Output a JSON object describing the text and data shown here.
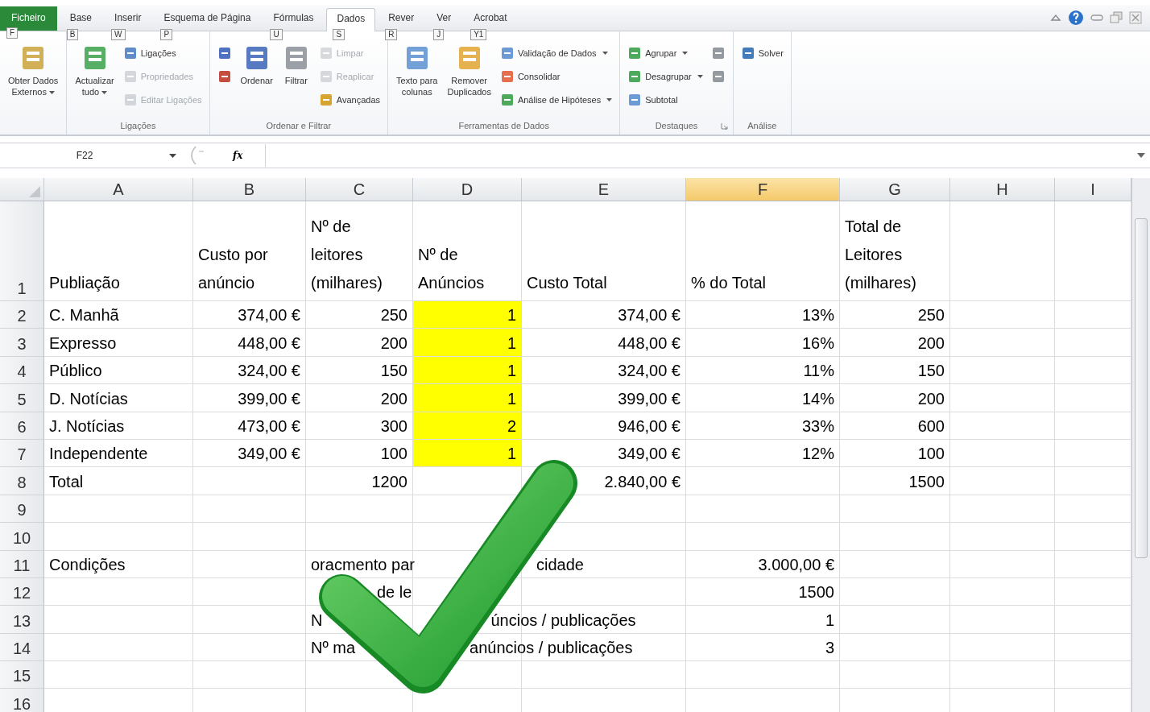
{
  "tabs": [
    {
      "label": "Ficheiro",
      "keytip": "F",
      "kind": "file",
      "selected": false
    },
    {
      "label": "Base",
      "keytip": "B",
      "kind": "tab",
      "selected": false
    },
    {
      "label": "Inserir",
      "keytip": "W",
      "kind": "tab",
      "selected": false
    },
    {
      "label": "Esquema de Página",
      "keytip": "P",
      "kind": "tab",
      "selected": false
    },
    {
      "label": "Fórmulas",
      "keytip": "U",
      "kind": "tab",
      "selected": false
    },
    {
      "label": "Dados",
      "keytip": "S",
      "kind": "tab",
      "selected": true
    },
    {
      "label": "Rever",
      "keytip": "R",
      "kind": "tab",
      "selected": false
    },
    {
      "label": "Ver",
      "keytip": "J",
      "kind": "tab",
      "selected": false
    },
    {
      "label": "Acrobat",
      "keytip": "Y1",
      "kind": "tab",
      "selected": false
    }
  ],
  "ribbon_groups": [
    {
      "items": [
        {
          "label": "Obter Dados\nExternos",
          "kind": "large",
          "dropdown": true,
          "disabled": false
        }
      ]
    },
    {
      "label": "Ligações",
      "items": [
        {
          "label": "Actualizar\ntudo",
          "kind": "large",
          "dropdown": true,
          "disabled": false
        },
        {
          "label": "Ligações",
          "kind": "small",
          "dropdown": false,
          "disabled": false
        },
        {
          "label": "Propriedades",
          "kind": "small",
          "dropdown": false,
          "disabled": true
        },
        {
          "label": "Editar Ligações",
          "kind": "small",
          "dropdown": false,
          "disabled": true
        }
      ]
    },
    {
      "label": "Ordenar e Filtrar",
      "items": [
        {
          "kind": "small",
          "dropdown": false,
          "disabled": false
        },
        {
          "kind": "small",
          "dropdown": false,
          "disabled": false
        },
        {
          "label": "Ordenar",
          "kind": "large",
          "dropdown": false,
          "disabled": false
        },
        {
          "label": "Filtrar",
          "kind": "large",
          "dropdown": false,
          "disabled": false
        },
        {
          "label": "Limpar",
          "kind": "small",
          "dropdown": false,
          "disabled": true
        },
        {
          "label": "Reaplicar",
          "kind": "small",
          "dropdown": false,
          "disabled": true
        },
        {
          "label": "Avançadas",
          "kind": "small",
          "dropdown": false,
          "disabled": false
        }
      ]
    },
    {
      "label": "Ferramentas de Dados",
      "items": [
        {
          "label": "Texto para\ncolunas",
          "kind": "large",
          "dropdown": false,
          "disabled": false
        },
        {
          "label": "Remover\nDuplicados",
          "kind": "large",
          "dropdown": false,
          "disabled": false
        },
        {
          "label": "Validação de Dados",
          "kind": "small",
          "dropdown": true,
          "disabled": false
        },
        {
          "label": "Consolidar",
          "kind": "small",
          "dropdown": false,
          "disabled": false
        },
        {
          "label": "Análise de Hipóteses",
          "kind": "small",
          "dropdown": true,
          "disabled": false
        }
      ]
    },
    {
      "label": "Destaques",
      "launcher": true,
      "items": [
        {
          "label": "Agrupar",
          "kind": "small",
          "dropdown": true,
          "disabled": false
        },
        {
          "label": "Desagrupar",
          "kind": "small",
          "dropdown": true,
          "disabled": false
        },
        {
          "label": "Subtotal",
          "kind": "small",
          "dropdown": false,
          "disabled": false
        },
        {
          "kind": "small",
          "dropdown": false,
          "disabled": false
        },
        {
          "kind": "small",
          "dropdown": false,
          "disabled": false
        }
      ]
    },
    {
      "label": "Análise",
      "launcher": false,
      "items": [
        {
          "label": "Solver",
          "kind": "small",
          "dropdown": false,
          "disabled": false
        }
      ]
    }
  ],
  "formula_bar": {
    "name_box": "F22",
    "function_label": "fx"
  },
  "columns": [
    {
      "label": "A",
      "selected": false
    },
    {
      "label": "B",
      "selected": false
    },
    {
      "label": "C",
      "selected": false
    },
    {
      "label": "D",
      "selected": false
    },
    {
      "label": "E",
      "selected": false
    },
    {
      "label": "F",
      "selected": true
    },
    {
      "label": "G",
      "selected": false
    },
    {
      "label": "H",
      "selected": false
    },
    {
      "label": "I",
      "selected": false
    }
  ],
  "rows": [
    {
      "header": "1",
      "cells": [
        {
          "text": "Publiação",
          "kind": "text"
        },
        {
          "text": "Custo por\nanúncio",
          "kind": "text"
        },
        {
          "text": "Nº de\nleitores\n(milhares)",
          "kind": "text"
        },
        {
          "text": "Nº de\nAnúncios",
          "kind": "text"
        },
        {
          "text": "Custo Total",
          "kind": "text"
        },
        {
          "text": "% do Total",
          "kind": "text"
        },
        {
          "text": "Total de\nLeitores\n(milhares)",
          "kind": "text"
        },
        null,
        null
      ]
    },
    {
      "header": "2",
      "cells": [
        {
          "text": "C. Manhã",
          "kind": "text"
        },
        {
          "text": "374,00 €",
          "kind": "number"
        },
        {
          "text": "250",
          "kind": "number"
        },
        {
          "text": "1",
          "kind": "number",
          "color": "#ffff00"
        },
        {
          "text": "374,00 €",
          "kind": "number"
        },
        {
          "text": "13%",
          "kind": "number"
        },
        {
          "text": "250",
          "kind": "number"
        },
        null,
        null
      ]
    },
    {
      "header": "3",
      "cells": [
        {
          "text": "Expresso",
          "kind": "text"
        },
        {
          "text": "448,00 €",
          "kind": "number"
        },
        {
          "text": "200",
          "kind": "number"
        },
        {
          "text": "1",
          "kind": "number",
          "color": "#ffff00"
        },
        {
          "text": "448,00 €",
          "kind": "number"
        },
        {
          "text": "16%",
          "kind": "number"
        },
        {
          "text": "200",
          "kind": "number"
        },
        null,
        null
      ]
    },
    {
      "header": "4",
      "cells": [
        {
          "text": "Público",
          "kind": "text"
        },
        {
          "text": "324,00 €",
          "kind": "number"
        },
        {
          "text": "150",
          "kind": "number"
        },
        {
          "text": "1",
          "kind": "number",
          "color": "#ffff00"
        },
        {
          "text": "324,00 €",
          "kind": "number"
        },
        {
          "text": "11%",
          "kind": "number"
        },
        {
          "text": "150",
          "kind": "number"
        },
        null,
        null
      ]
    },
    {
      "header": "5",
      "cells": [
        {
          "text": "D. Notícias",
          "kind": "text"
        },
        {
          "text": "399,00 €",
          "kind": "number"
        },
        {
          "text": "200",
          "kind": "number"
        },
        {
          "text": "1",
          "kind": "number",
          "color": "#ffff00"
        },
        {
          "text": "399,00 €",
          "kind": "number"
        },
        {
          "text": "14%",
          "kind": "number"
        },
        {
          "text": "200",
          "kind": "number"
        },
        null,
        null
      ]
    },
    {
      "header": "6",
      "cells": [
        {
          "text": "J. Notícias",
          "kind": "text"
        },
        {
          "text": "473,00 €",
          "kind": "number"
        },
        {
          "text": "300",
          "kind": "number"
        },
        {
          "text": "2",
          "kind": "number",
          "color": "#ffff00"
        },
        {
          "text": "946,00 €",
          "kind": "number"
        },
        {
          "text": "33%",
          "kind": "number"
        },
        {
          "text": "600",
          "kind": "number"
        },
        null,
        null
      ]
    },
    {
      "header": "7",
      "cells": [
        {
          "text": "Independente",
          "kind": "text"
        },
        {
          "text": "349,00 €",
          "kind": "number"
        },
        {
          "text": "100",
          "kind": "number"
        },
        {
          "text": "1",
          "kind": "number",
          "color": "#ffff00"
        },
        {
          "text": "349,00 €",
          "kind": "number"
        },
        {
          "text": "12%",
          "kind": "number"
        },
        {
          "text": "100",
          "kind": "number"
        },
        null,
        null
      ]
    },
    {
      "header": "8",
      "cells": [
        {
          "text": "Total",
          "kind": "text"
        },
        null,
        {
          "text": "1200",
          "kind": "number"
        },
        null,
        {
          "text": "2.840,00 €",
          "kind": "number"
        },
        null,
        {
          "text": "1500",
          "kind": "number"
        },
        null,
        null
      ]
    },
    {
      "header": "9",
      "cells": [
        null,
        null,
        null,
        null,
        null,
        null,
        null,
        null,
        null
      ]
    },
    {
      "header": "10",
      "cells": [
        null,
        null,
        null,
        null,
        null,
        null,
        null,
        null,
        null
      ]
    },
    {
      "header": "11",
      "cells": [
        {
          "text": "Condições",
          "kind": "text"
        },
        null,
        {
          "parts": [
            "oracmento par",
            "cidade"
          ],
          "kind": "overflow"
        },
        null,
        null,
        {
          "text": "3.000,00 €",
          "kind": "number"
        },
        null,
        null,
        null
      ]
    },
    {
      "header": "12",
      "cells": [
        null,
        null,
        {
          "parts": [
            "de le"
          ],
          "kind": "overflow"
        },
        null,
        null,
        {
          "text": "1500",
          "kind": "number"
        },
        null,
        null,
        null
      ]
    },
    {
      "header": "13",
      "cells": [
        null,
        null,
        {
          "parts": [
            "N",
            "úncios / publicações"
          ],
          "kind": "overflow"
        },
        null,
        null,
        {
          "text": "1",
          "kind": "number"
        },
        null,
        null,
        null
      ]
    },
    {
      "header": "14",
      "cells": [
        null,
        null,
        {
          "parts": [
            "Nº ma",
            "anúncios / publicações"
          ],
          "kind": "overflow"
        },
        null,
        null,
        {
          "text": "3",
          "kind": "number"
        },
        null,
        null,
        null
      ]
    },
    {
      "header": "15",
      "cells": [
        null,
        null,
        null,
        null,
        null,
        null,
        null,
        null,
        null
      ]
    },
    {
      "header": "16",
      "cells": [
        null,
        null,
        null,
        null,
        null,
        null,
        null,
        null,
        null
      ]
    }
  ]
}
